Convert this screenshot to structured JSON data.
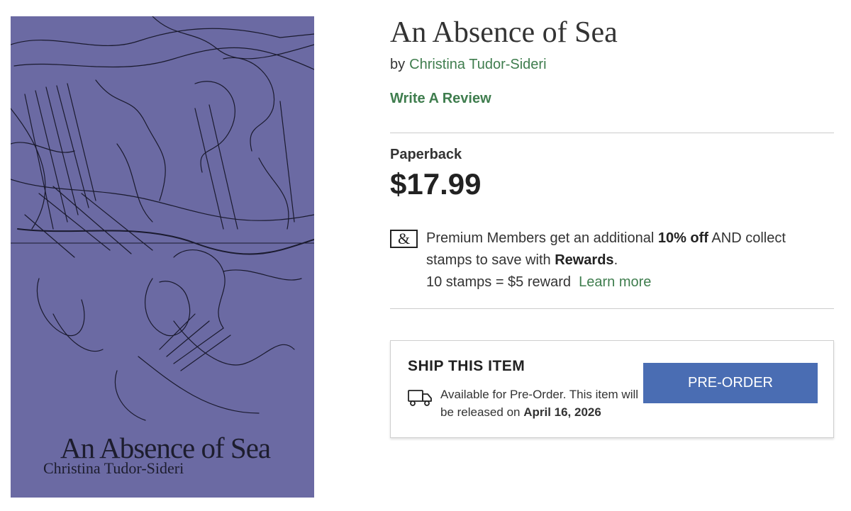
{
  "cover": {
    "title": "An Absence of Sea",
    "author": "Christina Tudor-Sideri"
  },
  "product": {
    "title": "An Absence of Sea",
    "by_label": "by",
    "author": "Christina Tudor-Sideri",
    "review_link": "Write A Review",
    "format": "Paperback",
    "price": "$17.99"
  },
  "membership": {
    "icon": "ampersand-icon",
    "icon_glyph": "&",
    "text_1": "Premium Members get an additional ",
    "discount": "10% off",
    "text_2": " AND collect stamps to save with ",
    "rewards": "Rewards",
    "text_3": ".",
    "stamps": "10 stamps = $5 reward",
    "learn_more": "Learn more"
  },
  "shipping": {
    "heading": "SHIP THIS ITEM",
    "icon": "truck-icon",
    "availability": "Available for Pre-Order. This item will be released on ",
    "release_date": "April 16, 2026",
    "button_label": "PRE-ORDER"
  },
  "colors": {
    "link_green": "#3f7d4e",
    "button_blue": "#4a6db3",
    "cover_purple": "#6b6aa3"
  }
}
